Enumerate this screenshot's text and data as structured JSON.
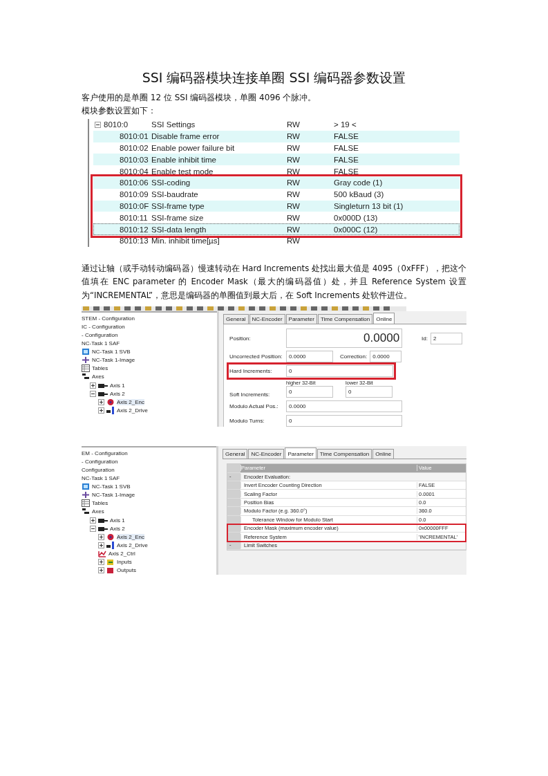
{
  "title": "SSI 编码器模块连接单圈 SSI 编码器参数设置",
  "intro": [
    "客户使用的是单圈 12 位 SSI 编码器模块，单圈 4096 个脉冲。",
    "模块参数设置如下："
  ],
  "settings_table": {
    "rows": [
      {
        "index": "8010:0",
        "name": "SSI Settings",
        "access": "RW",
        "value": "> 19 <",
        "expanded": true,
        "selected": false,
        "highlighted": false
      },
      {
        "index": "8010:01",
        "name": "Disable frame error",
        "access": "RW",
        "value": "FALSE",
        "selected": false,
        "highlighted": false
      },
      {
        "index": "8010:02",
        "name": "Enable power failure bit",
        "access": "RW",
        "value": "FALSE",
        "selected": false,
        "highlighted": false
      },
      {
        "index": "8010:03",
        "name": "Enable inhibit time",
        "access": "RW",
        "value": "FALSE",
        "selected": false,
        "highlighted": false
      },
      {
        "index": "8010:04",
        "name": "Enable test mode",
        "access": "RW",
        "value": "FALSE",
        "selected": false,
        "highlighted": false
      },
      {
        "index": "8010:06",
        "name": "SSI-coding",
        "access": "RW",
        "value": "Gray code (1)",
        "selected": false,
        "highlighted": true
      },
      {
        "index": "8010:09",
        "name": "SSI-baudrate",
        "access": "RW",
        "value": "500 kBaud (3)",
        "selected": false,
        "highlighted": true
      },
      {
        "index": "8010:0F",
        "name": "SSI-frame type",
        "access": "RW",
        "value": "Singleturn 13 bit (1)",
        "selected": false,
        "highlighted": true
      },
      {
        "index": "8010:11",
        "name": "SSI-frame size",
        "access": "RW",
        "value": "0x000D (13)",
        "selected": false,
        "highlighted": true
      },
      {
        "index": "8010:12",
        "name": "SSI-data length",
        "access": "RW",
        "value": "0x000C (12)",
        "selected": true,
        "highlighted": true
      },
      {
        "index": "8010:13",
        "name": "Min. inhibit time[µs]",
        "access": "RW",
        "value": "",
        "selected": false,
        "highlighted": false
      }
    ]
  },
  "paragraph": "通过让轴（或手动转动编码器）慢速转动在 Hard Increments 处找出最大值是 4095（0xFFF），把这个值填在 ENC parameter 的 Encoder Mask（最大的编码器值）处，并且 Reference System 设置为“INCREMENTAL”，意思是编码器的单圈值到最大后，在 Soft Increments 处软件进位。",
  "screenshot_online": {
    "tree": [
      {
        "label": "STEM - Configuration",
        "kind": "none"
      },
      {
        "label": "IC - Configuration",
        "kind": "none"
      },
      {
        "label": "- Configuration",
        "kind": "none"
      },
      {
        "label": "NC-Task 1 SAF",
        "kind": "none"
      },
      {
        "label": "NC-Task 1 SVB",
        "kind": "task"
      },
      {
        "label": "NC-Task 1-Image",
        "kind": "image"
      },
      {
        "label": "Tables",
        "kind": "table"
      },
      {
        "label": "Axes",
        "kind": "axes",
        "children": [
          {
            "label": "Axis 1",
            "kind": "axis",
            "expanded": false
          },
          {
            "label": "Axis 2",
            "kind": "axis",
            "expanded": true,
            "children": [
              {
                "label": "Axis 2_Enc",
                "kind": "encoder",
                "expanded": false,
                "selected": true
              },
              {
                "label": "Axis 2_Drive",
                "kind": "drive",
                "expanded": false,
                "selected": false
              }
            ]
          }
        ]
      }
    ],
    "tabs": [
      {
        "label": "General",
        "selected": false
      },
      {
        "label": "NC-Encoder",
        "selected": false
      },
      {
        "label": "Parameter",
        "selected": false
      },
      {
        "label": "Time Compensation",
        "selected": false
      },
      {
        "label": "Online",
        "selected": true
      }
    ],
    "position": {
      "label": "Position:",
      "value": "0.0000"
    },
    "id": {
      "label": "Id:",
      "value": "2"
    },
    "uncorrected_position": {
      "label": "Uncorrected Position:",
      "value": "0.0000"
    },
    "correction": {
      "label": "Correction:",
      "value": "0.0000"
    },
    "hard_increments": {
      "label": "Hard Increments:",
      "value": "0",
      "highlighted": true
    },
    "soft_increments": {
      "label": "Soft Increments:",
      "higher_label": "higher 32-Bit",
      "higher_value": "0",
      "lower_label": "lower 32-Bit",
      "lower_value": "0"
    },
    "modulo_actual_pos": {
      "label": "Modulo Actual Pos.:",
      "value": "0.0000"
    },
    "modulo_turns": {
      "label": "Modulo Turns:",
      "value": "0"
    }
  },
  "screenshot_parameter": {
    "tree": [
      {
        "label": "EM - Configuration",
        "kind": "none"
      },
      {
        "label": "- Configuration",
        "kind": "none"
      },
      {
        "label": "Configuration",
        "kind": "none"
      },
      {
        "label": "NC-Task 1 SAF",
        "kind": "none"
      },
      {
        "label": "NC-Task 1 SVB",
        "kind": "task"
      },
      {
        "label": "NC-Task 1-Image",
        "kind": "image"
      },
      {
        "label": "Tables",
        "kind": "table"
      },
      {
        "label": "Axes",
        "kind": "axes",
        "children": [
          {
            "label": "Axis 1",
            "kind": "axis",
            "expanded": false
          },
          {
            "label": "Axis 2",
            "kind": "axis",
            "expanded": true,
            "children": [
              {
                "label": "Axis 2_Enc",
                "kind": "encoder",
                "expanded": false,
                "selected": true
              },
              {
                "label": "Axis 2_Drive",
                "kind": "drive",
                "expanded": false,
                "selected": false
              },
              {
                "label": "Axis 2_Ctrl",
                "kind": "ctrl",
                "selected": false
              },
              {
                "label": "Inputs",
                "kind": "inputs",
                "expanded": false,
                "selected": false
              },
              {
                "label": "Outputs",
                "kind": "outputs",
                "expanded": false,
                "selected": false
              }
            ]
          }
        ]
      }
    ],
    "tabs": [
      {
        "label": "General",
        "selected": false
      },
      {
        "label": "NC-Encoder",
        "selected": false
      },
      {
        "label": "Parameter",
        "selected": true
      },
      {
        "label": "Time Compensation",
        "selected": false
      },
      {
        "label": "Online",
        "selected": false
      }
    ],
    "columns": [
      "Parameter",
      "Value"
    ],
    "rows": [
      {
        "kind": "group",
        "marker": "-",
        "name": "Encoder Evaluation:",
        "value": "",
        "highlighted": false
      },
      {
        "kind": "param",
        "name": "Invert Encoder Counting Direction",
        "value": "FALSE",
        "highlighted": false
      },
      {
        "kind": "param",
        "name": "Scaling Factor",
        "value": "0.0001",
        "highlighted": false
      },
      {
        "kind": "param",
        "name": "Position Bias",
        "value": "0.0",
        "highlighted": false
      },
      {
        "kind": "param",
        "name": "Modulo Factor (e.g. 360.0°)",
        "value": "360.0",
        "highlighted": false,
        "children": [
          {
            "kind": "param",
            "name": "Tolerance Window for Modulo Start",
            "value": "0.0",
            "highlighted": false
          }
        ]
      },
      {
        "kind": "param",
        "name": "Encoder Mask (maximum encoder value)",
        "value": "0x00000FFF",
        "highlighted": true
      },
      {
        "kind": "param",
        "name": "Reference System",
        "value": "'INCREMENTAL'",
        "highlighted": true
      },
      {
        "kind": "group",
        "marker": "-",
        "name": "Limit Switches",
        "value": "",
        "highlighted": false
      }
    ]
  }
}
